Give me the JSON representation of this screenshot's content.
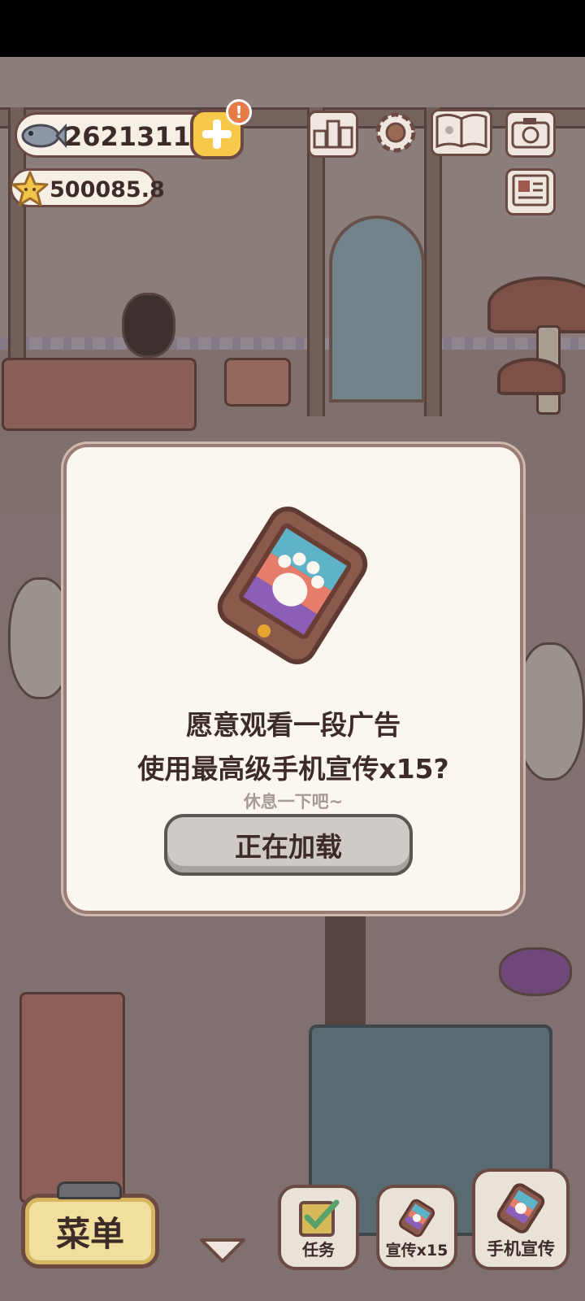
{
  "hud": {
    "fish_count": "2621311",
    "star_count": "500085.8",
    "alert_badge": "!",
    "icons": [
      "fish-icon",
      "star-icon",
      "plus-icon",
      "ranking-icon",
      "settings-gear-icon",
      "cat-book-icon",
      "camera-icon",
      "newspaper-icon"
    ]
  },
  "dialog": {
    "icon": "phone-paw-icon",
    "title_line1": "愿意观看一段广告",
    "title_line2": "使用最高级手机宣传x15?",
    "subtitle": "休息一下吧~",
    "button_label": "正在加载"
  },
  "bottom_bar": {
    "menu_label": "菜单",
    "task_label": "任务",
    "promo15_label": "宣传x15",
    "phone_promo_label": "手机宣传"
  },
  "colors": {
    "dialog_bg": "#fbf6ef",
    "button_gray": "#cfcac6",
    "accent_yellow": "#f6c94a",
    "alert_orange": "#e57b46",
    "text_dark": "#3d2b27"
  }
}
